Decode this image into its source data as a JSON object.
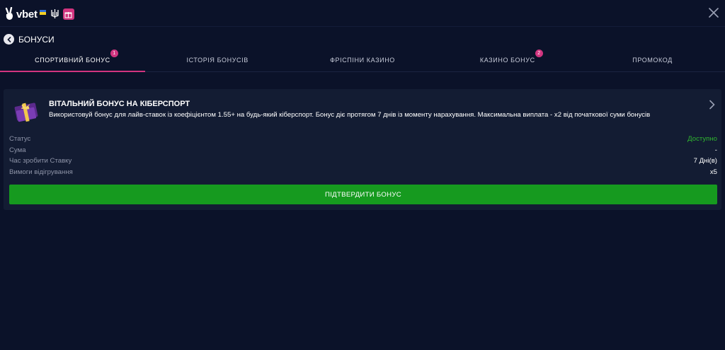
{
  "header": {
    "logo_text": "vbet",
    "flag_colors": [
      "#2f6fd6",
      "#f5cf22"
    ],
    "gift_icon": "gift-box-icon",
    "close_icon": "close-icon"
  },
  "nav": {
    "back_icon": "back-arrow-icon",
    "title": "БОНУСИ"
  },
  "tabs": [
    {
      "label": "СПОРТИВНИЙ БОНУС",
      "badge": "1",
      "active": true
    },
    {
      "label": "ІСТОРІЯ БОНУСІВ",
      "badge": "",
      "active": false
    },
    {
      "label": "ФРІСПІНИ КАЗИНО",
      "badge": "",
      "active": false
    },
    {
      "label": "КАЗИНО БОНУС",
      "badge": "2",
      "active": false
    },
    {
      "label": "ПРОМОКОД",
      "badge": "",
      "active": false
    }
  ],
  "bonus_card": {
    "icon": "gift-icon",
    "title": "ВІТАЛЬНИЙ БОНУС НА КІБЕРСПОРТ",
    "description": "Використовуй бонус для лайв-ставок із коефіцієнтом 1.55+ на будь-який кіберспорт. Бонус діє протягом 7 днів із моменту нарахування. Максимальна виплата - х2 від початкової суми бонусів",
    "rows": [
      {
        "label": "Статус",
        "value": "Доступно"
      },
      {
        "label": "Сума",
        "value": "-"
      },
      {
        "label": "Час зробити Ставку",
        "value": "7 Дні(в)"
      },
      {
        "label": "Вимоги відігрування",
        "value": "x5"
      }
    ],
    "confirm_label": "ПІДТВЕРДИТИ БОНУС"
  },
  "colors": {
    "background": "#0b1229",
    "card": "#131c33",
    "accent": "#d1347f",
    "success": "#2fb52f",
    "button": "#169a1f"
  }
}
